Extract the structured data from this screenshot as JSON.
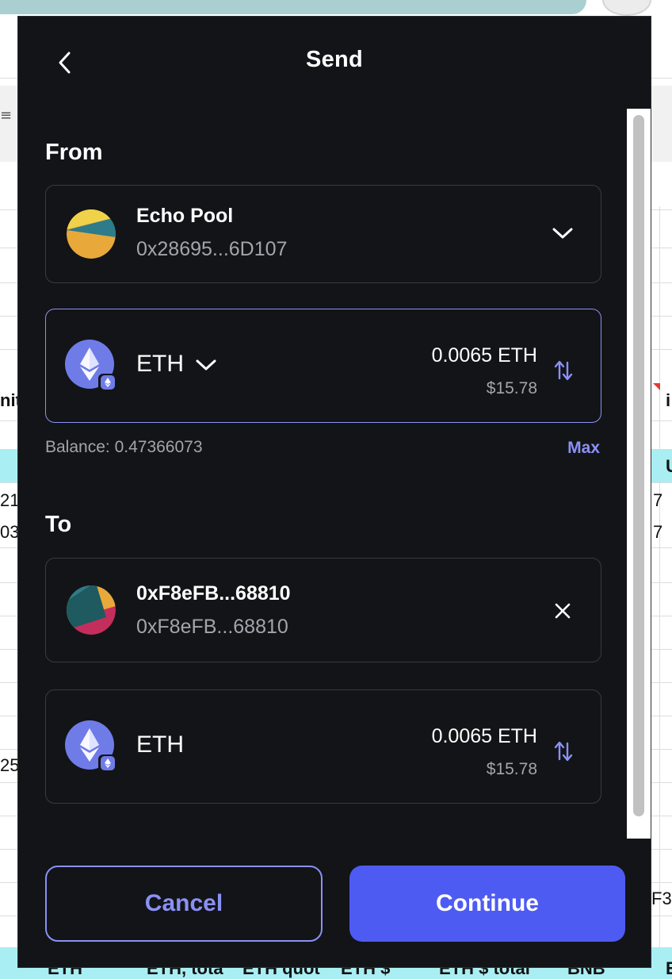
{
  "header": {
    "title": "Send"
  },
  "from": {
    "section_label": "From",
    "account": {
      "name": "Echo Pool",
      "address": "0x28695...6D107"
    },
    "token": {
      "symbol": "ETH",
      "amount_crypto": "0.0065 ETH",
      "amount_fiat": "$15.78",
      "icon": "ethereum-logo"
    },
    "balance_label": "Balance:",
    "balance_value": "0.47366073",
    "max_label": "Max"
  },
  "to": {
    "section_label": "To",
    "account": {
      "name": "0xF8eFB...68810",
      "address": "0xF8eFB...68810"
    },
    "token": {
      "symbol": "ETH",
      "amount_crypto": "0.0065 ETH",
      "amount_fiat": "$15.78",
      "icon": "ethereum-logo"
    }
  },
  "actions": {
    "cancel_label": "Cancel",
    "continue_label": "Continue"
  },
  "colors": {
    "modal_bg": "#131417",
    "accent": "#8a91f5",
    "primary_button": "#4e5bf2",
    "eth_logo": "#6f7ce8",
    "muted_text": "#a3a5ad"
  },
  "background": {
    "cell_texts": [
      "nit",
      "21",
      "03",
      "25",
      "i",
      "U",
      "7",
      "7",
      "F3",
      "ETH",
      "ETH, tota",
      "ETH quot",
      "ETH $",
      "ETH $ total",
      "BNB",
      "E"
    ]
  }
}
